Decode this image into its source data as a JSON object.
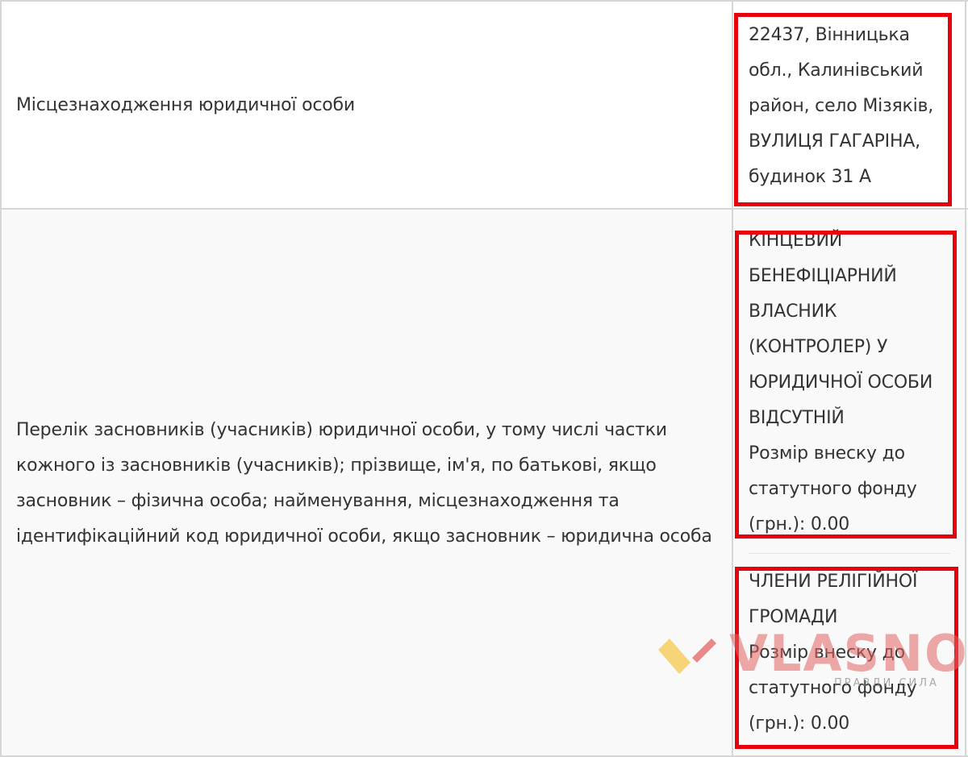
{
  "rows": [
    {
      "label": "Місцезнаходження юридичної особи",
      "value_lines": [
        "22437, Вінницька",
        "обл., Калинівський",
        "район, село Мізяків,",
        "ВУЛИЦЯ ГАГАРІНА,",
        "будинок 31 А"
      ]
    },
    {
      "label_lines": [
        "Перелік засновників (учасників) юридичної особи, у тому числі частки",
        "кожного із засновників (учасників); прізвище, ім'я, по батькові, якщо",
        "засновник – фізична особа; найменування, місцезнаходження та",
        "ідентифікаційний код юридичної особи, якщо засновник – юридична особа"
      ],
      "founders": [
        {
          "lines": [
            "КІНЦЕВИЙ",
            "БЕНЕФІЦІАРНИЙ",
            "ВЛАСНИК",
            "(КОНТРОЛЕР) У",
            "ЮРИДИЧНОЇ ОСОБИ",
            "ВІДСУТНІЙ",
            "Розмір внеску до",
            "статутного фонду",
            "(грн.): 0.00"
          ]
        },
        {
          "lines": [
            "ЧЛЕНИ РЕЛІГІЙНОЇ",
            "ГРОМАДИ",
            "Розмір внеску до",
            "статутного фонду",
            "(грн.): 0.00"
          ]
        }
      ]
    }
  ],
  "watermark": {
    "brand": "VLASNO",
    "tagline": "ПРАВДИ СИЛА"
  },
  "colors": {
    "highlight": "#e8000b",
    "border": "#d6d6d6",
    "text": "#333333"
  }
}
